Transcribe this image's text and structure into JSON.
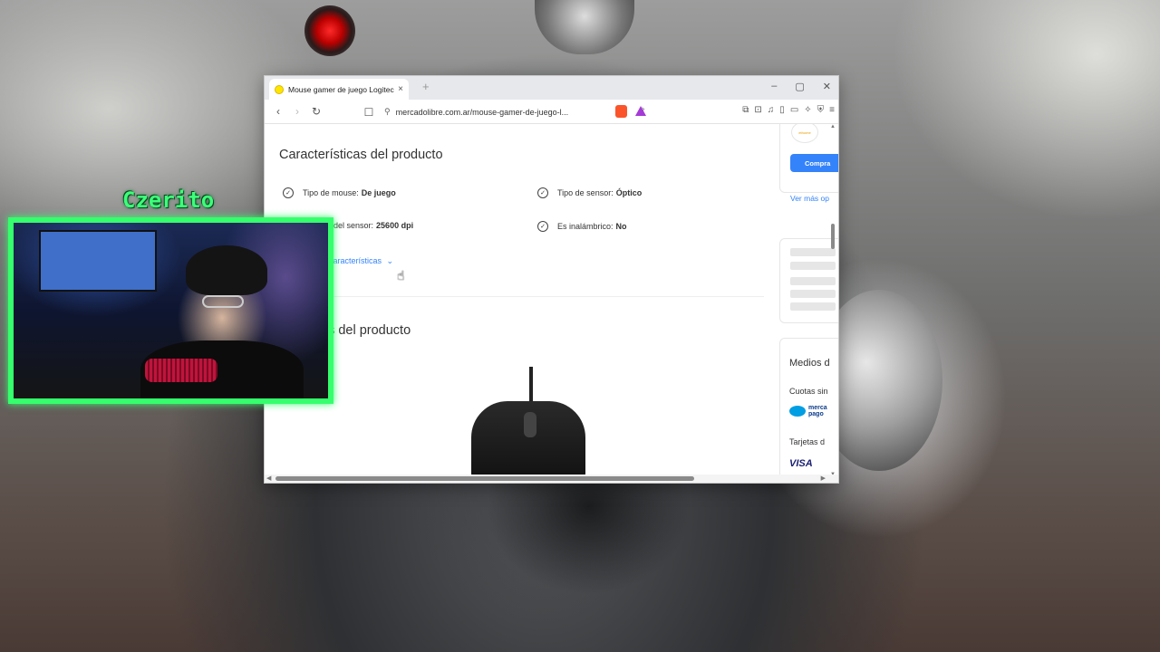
{
  "streamer": {
    "name": "Czerito"
  },
  "browser": {
    "tab": {
      "title": "Mouse gamer de juego Logitech",
      "close": "×"
    },
    "new_tab": "+",
    "window_controls": [
      "–",
      "▢",
      "✕"
    ],
    "toolbar": {
      "back": "‹",
      "forward": "›",
      "reload": "↻",
      "bookmark": "☐",
      "url": "mercadolibre.com.ar/mouse-gamer-de-juego-l...",
      "right_icons": [
        "⧉",
        "⊡",
        "♫",
        "▯",
        "▭",
        "✧",
        "⛨",
        "≡"
      ]
    }
  },
  "page": {
    "characteristics_title": "Características del producto",
    "features": [
      {
        "label": "Tipo de mouse:",
        "value": "De juego"
      },
      {
        "label": "Tipo de sensor:",
        "value": "Óptico"
      },
      {
        "label": "ución del sensor:",
        "value": "25600 dpi"
      },
      {
        "label": "Es inalámbrico:",
        "value": "No"
      }
    ],
    "more_characteristics": "características",
    "images_title": "es del producto"
  },
  "sidebar": {
    "seller_logo": "ethome",
    "buy_button": "Compra",
    "see_more": "Ver más op",
    "payment_title": "Medios d",
    "installments": "Cuotas sin",
    "mercadopago": "merca pago",
    "cards": "Tarjetas d",
    "visa": "VISA"
  }
}
